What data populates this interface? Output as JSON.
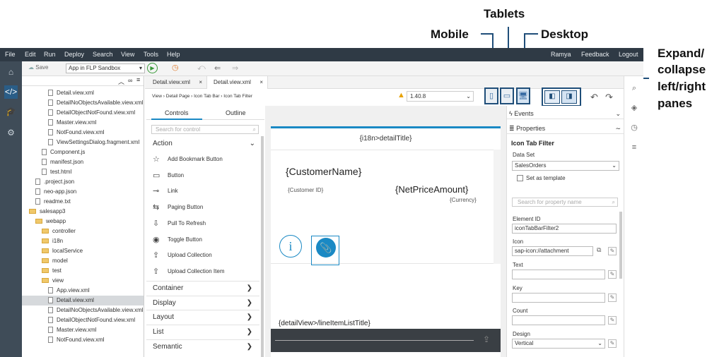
{
  "callouts": {
    "mobile": "Mobile",
    "tablets": "Tablets",
    "desktop": "Desktop",
    "panes": [
      "Expand/",
      "collapse",
      "left/right",
      "panes"
    ]
  },
  "menu": {
    "items": [
      "File",
      "Edit",
      "Run",
      "Deploy",
      "Search",
      "View",
      "Tools",
      "Help"
    ],
    "right": [
      "Ramya",
      "Feedback",
      "Logout"
    ]
  },
  "toolbar": {
    "save": "Save",
    "run_config": "App in FLP Sandbox"
  },
  "tree": {
    "rows": [
      {
        "label": "Detail.view.xml",
        "type": "file",
        "indent": 4
      },
      {
        "label": "DetailNoObjectsAvailable.view.xml",
        "type": "file",
        "indent": 4
      },
      {
        "label": "DetailObjectNotFound.view.xml",
        "type": "file",
        "indent": 4
      },
      {
        "label": "Master.view.xml",
        "type": "file",
        "indent": 4
      },
      {
        "label": "NotFound.view.xml",
        "type": "file",
        "indent": 4
      },
      {
        "label": "ViewSettingsDialog.fragment.xml",
        "type": "file",
        "indent": 4
      },
      {
        "label": "Component.js",
        "type": "file",
        "indent": 3
      },
      {
        "label": "manifest.json",
        "type": "file",
        "indent": 3
      },
      {
        "label": "test.html",
        "type": "file",
        "indent": 3
      },
      {
        "label": ".project.json",
        "type": "file",
        "indent": 2
      },
      {
        "label": "neo-app.json",
        "type": "file",
        "indent": 2
      },
      {
        "label": "readme.txt",
        "type": "file",
        "indent": 2
      },
      {
        "label": "salesapp3",
        "type": "folder",
        "indent": 1
      },
      {
        "label": "webapp",
        "type": "folder",
        "indent": 2
      },
      {
        "label": "controller",
        "type": "folder",
        "indent": 3
      },
      {
        "label": "i18n",
        "type": "folder",
        "indent": 3
      },
      {
        "label": "localService",
        "type": "folder",
        "indent": 3
      },
      {
        "label": "model",
        "type": "folder",
        "indent": 3
      },
      {
        "label": "test",
        "type": "folder",
        "indent": 3
      },
      {
        "label": "view",
        "type": "folder",
        "indent": 3
      },
      {
        "label": "App.view.xml",
        "type": "file",
        "indent": 4
      },
      {
        "label": "Detail.view.xml",
        "type": "file",
        "indent": 4,
        "selected": true
      },
      {
        "label": "DetailNoObjectsAvailable.view.xml",
        "type": "file",
        "indent": 4
      },
      {
        "label": "DetailObjectNotFound.view.xml",
        "type": "file",
        "indent": 4
      },
      {
        "label": "Master.view.xml",
        "type": "file",
        "indent": 4
      },
      {
        "label": "NotFound.view.xml",
        "type": "file",
        "indent": 4
      }
    ]
  },
  "tabs": [
    {
      "label": "Detail.view.xml"
    },
    {
      "label": "Detail.view.xml"
    }
  ],
  "breadcrumb": "View › Detail Page › Icon Tab Bar › Icon Tab Filter",
  "version": "1.40.8",
  "palette": {
    "tabs": [
      "Controls",
      "Outline"
    ],
    "search_placeholder": "Search for control",
    "action_label": "Action",
    "controls": [
      {
        "label": "Add Bookmark Button",
        "icon": "☆"
      },
      {
        "label": "Button",
        "icon": "▭"
      },
      {
        "label": "Link",
        "icon": "⊸"
      },
      {
        "label": "Paging Button",
        "icon": "⇆"
      },
      {
        "label": "Pull To Refresh",
        "icon": "⇩"
      },
      {
        "label": "Toggle Button",
        "icon": "◉"
      },
      {
        "label": "Upload Collection",
        "icon": "⇪"
      },
      {
        "label": "Upload Collection Item",
        "icon": "⇪"
      }
    ],
    "categories": [
      "Container",
      "Display",
      "Layout",
      "List",
      "Semantic"
    ]
  },
  "canvas": {
    "header": "{i18n>detailTitle}",
    "customer_name": "{CustomerName}",
    "customer_id": "{Customer ID}",
    "net_price": "{NetPriceAmount}",
    "currency": "{Currency}",
    "line_items_title": "{detailView>/lineItemListTitle}"
  },
  "properties": {
    "events_label": "Events",
    "properties_label": "Properties",
    "control_title": "Icon Tab Filter",
    "dataset_label": "Data Set",
    "dataset_value": "SalesOrders",
    "set_as_template": "Set as template",
    "search_placeholder": "Search for property name",
    "element_id_label": "Element ID",
    "element_id_value": "iconTabBarFilter2",
    "icon_label": "Icon",
    "icon_value": "sap-icon://attachment",
    "text_label": "Text",
    "key_label": "Key",
    "count_label": "Count",
    "design_label": "Design",
    "design_value": "Vertical"
  },
  "colors": {
    "menubar": "#2f3a45",
    "rail": "#3f4c58",
    "accent": "#1a89c4",
    "callout": "#1f4e79"
  }
}
